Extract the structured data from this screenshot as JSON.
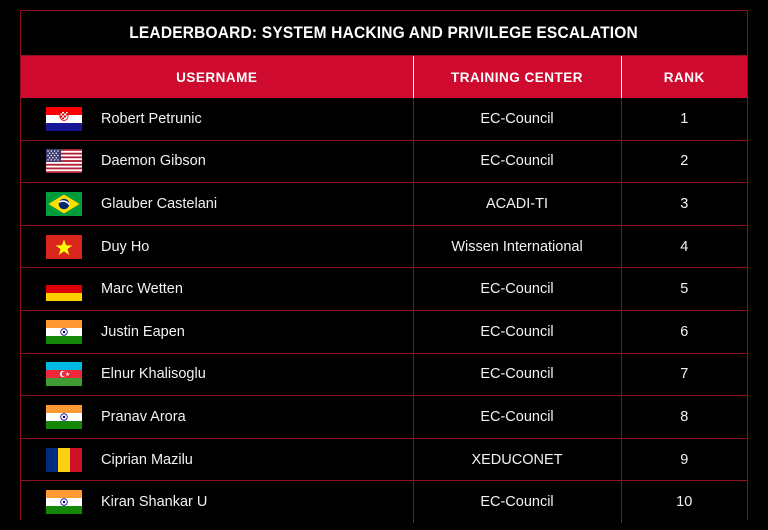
{
  "board": {
    "title": "LEADERBOARD: SYSTEM HACKING AND PRIVILEGE ESCALATION",
    "accent_color": "#CE0A2E",
    "border_color": "#8C1020",
    "background_color": "#000000",
    "text_color": "#F2F2F2"
  },
  "columns": [
    {
      "key": "username",
      "label": "USERNAME"
    },
    {
      "key": "training_center",
      "label": "TRAINING CENTER"
    },
    {
      "key": "rank",
      "label": "RANK"
    }
  ],
  "rows": [
    {
      "flag": "flag-croatia-icon",
      "username": "Robert Petrunic",
      "training_center": "EC-Council",
      "rank": "1"
    },
    {
      "flag": "flag-usa-icon",
      "username": "Daemon Gibson",
      "training_center": "EC-Council",
      "rank": "2"
    },
    {
      "flag": "flag-brazil-icon",
      "username": "Glauber Castelani",
      "training_center": "ACADI-TI",
      "rank": "3"
    },
    {
      "flag": "flag-vietnam-icon",
      "username": "Duy Ho",
      "training_center": "Wissen International",
      "rank": "4"
    },
    {
      "flag": "flag-germany-icon",
      "username": "Marc Wetten",
      "training_center": "EC-Council",
      "rank": "5"
    },
    {
      "flag": "flag-india-icon",
      "username": "Justin Eapen",
      "training_center": "EC-Council",
      "rank": "6"
    },
    {
      "flag": "flag-azerbaijan-icon",
      "username": "Elnur Khalisoglu",
      "training_center": "EC-Council",
      "rank": "7"
    },
    {
      "flag": "flag-india-icon",
      "username": "Pranav Arora",
      "training_center": "EC-Council",
      "rank": "8"
    },
    {
      "flag": "flag-romania-icon",
      "username": "Ciprian Mazilu",
      "training_center": "XEDUCONET",
      "rank": "9"
    },
    {
      "flag": "flag-india-icon",
      "username": "Kiran Shankar U",
      "training_center": "EC-Council",
      "rank": "10"
    }
  ]
}
